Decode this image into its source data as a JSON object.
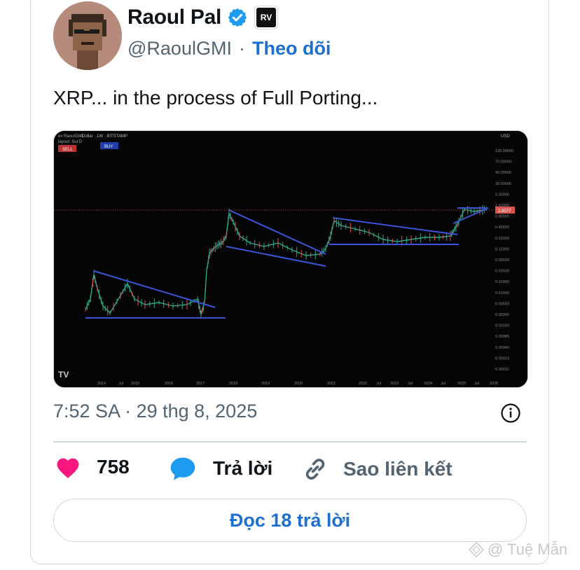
{
  "author": {
    "name": "Raoul Pal",
    "badge_text": "RV",
    "handle": "@RaoulGMI",
    "separator": "·",
    "follow_label": "Theo dõi"
  },
  "tweet": {
    "text": "XRP... in the process of Full Porting...",
    "timestamp": "7:52 SA · 29 thg 8, 2025"
  },
  "chart": {
    "header_text": "Dollar · 1W · BITSTAMP",
    "top_left_lines": [
      "ex RaoulGMI",
      "layout: Sul D"
    ],
    "sell_label": "SELL",
    "buy_label": "BUY",
    "currency_label": "USD",
    "x_ticks": [
      "2014",
      "Jul",
      "2015",
      "2016",
      "2017",
      "2018",
      "2019",
      "2020",
      "2021",
      "2022",
      "Jul",
      "2023",
      "Jul",
      "2024",
      "Jul",
      "2025",
      "Jul",
      "2026"
    ],
    "y_ticks": [
      "130.00000",
      "70.00000",
      "40.00000",
      "18.00000",
      "5.00000",
      "1.60000",
      "0.80000",
      "0.40000",
      "0.22000",
      "0.12000",
      "0.06500",
      "0.03500",
      "0.01900",
      "0.01000",
      "0.00550",
      "0.00300",
      "0.00160",
      "0.00085",
      "0.00040",
      "0.00023",
      "0.00012"
    ],
    "price_label": "2.8577",
    "colors": {
      "background": "#050505",
      "trendline": "#3a55d8",
      "price_line": "#c23b3b",
      "candle_up": "#2fa68a",
      "candle_down": "#d9534f"
    }
  },
  "actions": {
    "like_count": "758",
    "reply_label": "Trả lời",
    "copy_link_label": "Sao liên kết",
    "read_replies_label": "Đọc 18 trả lời"
  },
  "watermark": "@ Tuệ Mẫn",
  "colors": {
    "accent": "#1d6fd0",
    "like": "#f91880",
    "reply": "#1d9bf0",
    "muted": "#536471",
    "border": "#cfd9de"
  }
}
